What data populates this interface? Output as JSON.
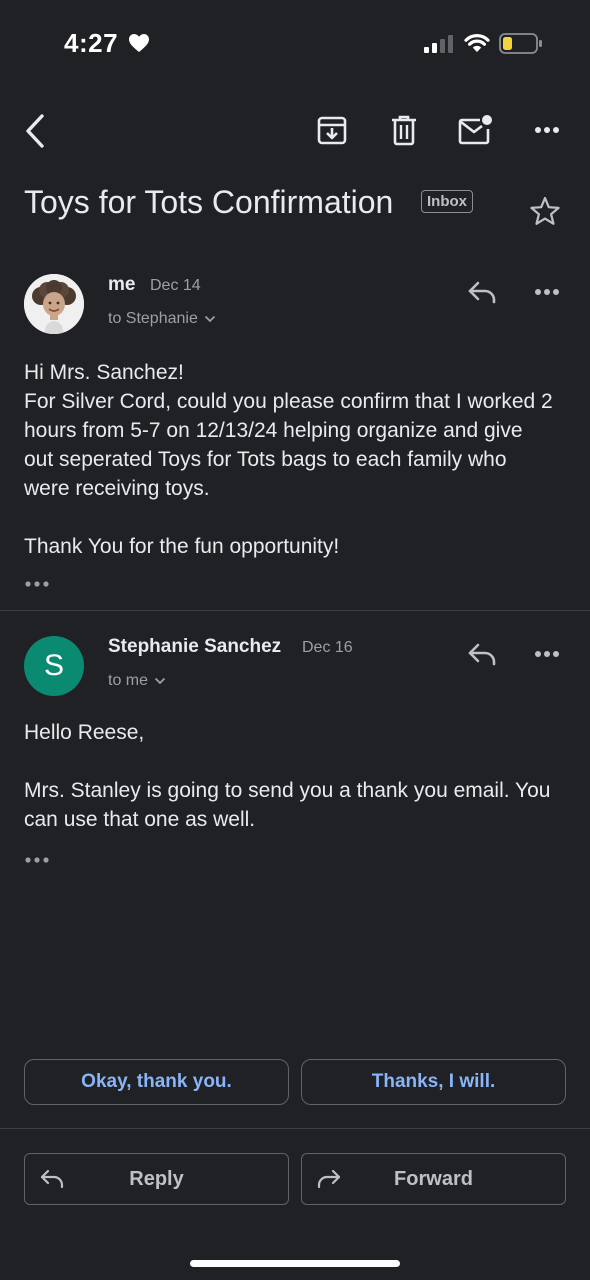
{
  "status_bar": {
    "time": "4:27",
    "heart_icon": "heart-icon",
    "signal_icon": "cellular-signal-icon",
    "wifi_icon": "wifi-icon",
    "battery_icon": "battery-icon",
    "battery_color": "#f3d33d"
  },
  "toolbar": {
    "back_icon": "back-arrow-icon",
    "archive_icon": "archive-icon",
    "delete_icon": "trash-icon",
    "mark_unread_icon": "mark-unread-icon",
    "more_icon": "more-horizontal-icon"
  },
  "subject": {
    "title": "Toys for Tots Confirmation",
    "label": "Inbox",
    "star_icon": "star-icon"
  },
  "messages": [
    {
      "sender": "me",
      "date": "Dec 14",
      "recipient": "to Stephanie",
      "avatar": "profile-photo",
      "body": [
        "Hi Mrs. Sanchez!",
        "For Silver Cord, could you please confirm that I worked 2 hours from 5-7 on 12/13/24 helping organize and give out seperated Toys for Tots bags to each family who were receiving toys.",
        "Thank You for the fun opportunity!"
      ]
    },
    {
      "sender": "Stephanie Sanchez",
      "date": "Dec 16",
      "recipient": "to me",
      "avatar_letter": "S",
      "avatar_color": "#0b8a72",
      "body": [
        "Hello Reese,",
        "Mrs. Stanley is going to send you a thank you email. You can use that one as well."
      ]
    }
  ],
  "smart_replies": [
    "Okay, thank you.",
    "Thanks, I will."
  ],
  "actions": {
    "reply": "Reply",
    "forward": "Forward"
  },
  "colors": {
    "background": "#202124",
    "accent": "#8ab4f8"
  }
}
